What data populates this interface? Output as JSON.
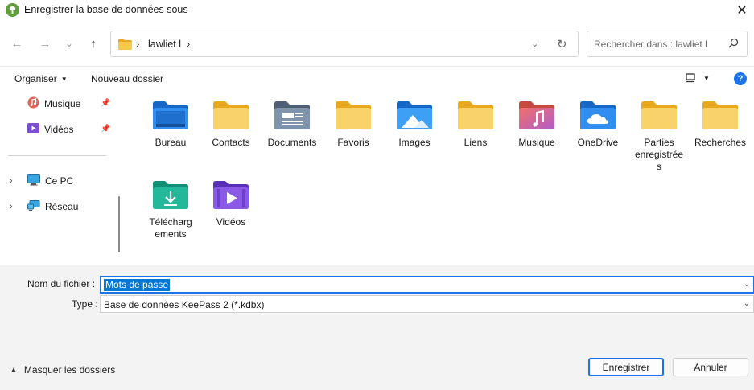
{
  "window": {
    "title": "Enregistrer la base de données sous",
    "close": "✕"
  },
  "nav": {
    "back": "←",
    "forward": "→",
    "recent": "⌄",
    "up": "↑"
  },
  "address": {
    "crumb": "lawliet l",
    "sep": "›",
    "dropdown": "⌄",
    "refresh": "↻"
  },
  "search": {
    "placeholder": "Rechercher dans : lawliet l"
  },
  "toolbar": {
    "organize": "Organiser",
    "new_folder": "Nouveau dossier",
    "help": "?"
  },
  "sidebar": {
    "quick": [
      {
        "label": "Musique",
        "icon": "music-icon"
      },
      {
        "label": "Vidéos",
        "icon": "video-icon"
      }
    ],
    "tree": [
      {
        "label": "Ce PC",
        "icon": "computer-icon"
      },
      {
        "label": "Réseau",
        "icon": "network-icon"
      }
    ]
  },
  "folders": [
    {
      "name": "Bureau",
      "icon": "desktop-folder-icon"
    },
    {
      "name": "Contacts",
      "icon": "folder-icon"
    },
    {
      "name": "Documents",
      "icon": "documents-folder-icon"
    },
    {
      "name": "Favoris",
      "icon": "folder-icon"
    },
    {
      "name": "Images",
      "icon": "pictures-folder-icon"
    },
    {
      "name": "Liens",
      "icon": "folder-icon"
    },
    {
      "name": "Musique",
      "icon": "music-folder-icon"
    },
    {
      "name": "OneDrive",
      "icon": "onedrive-folder-icon"
    },
    {
      "name": "Parties enregistrées",
      "icon": "folder-icon"
    },
    {
      "name": "Recherches",
      "icon": "folder-icon"
    },
    {
      "name": "Téléchargements",
      "icon": "downloads-folder-icon"
    },
    {
      "name": "Vidéos",
      "icon": "videos-folder-icon"
    }
  ],
  "form": {
    "filename_label": "Nom du fichier :",
    "filename_value": "Mots de passe",
    "type_label": "Type :",
    "type_value": "Base de données KeePass 2 (*.kdbx)"
  },
  "footer": {
    "hide_folders": "Masquer les dossiers",
    "save": "Enregistrer",
    "cancel": "Annuler"
  },
  "colors": {
    "accent": "#1a73e8",
    "folder": "#f7c948",
    "selection": "#0078d7"
  }
}
